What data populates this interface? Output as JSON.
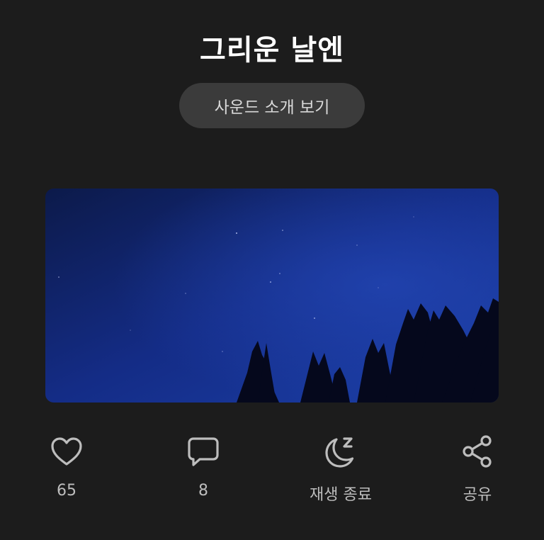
{
  "title": "그리운 날엔",
  "intro_button": "사운드 소개 보기",
  "cover_image": {
    "description_icon": "night-sky-image",
    "sky_color_top": "#0b1540",
    "sky_color_bottom": "#1a3a9e"
  },
  "actions": {
    "like": {
      "icon": "heart-icon",
      "label": "65"
    },
    "comment": {
      "icon": "comment-icon",
      "label": "8"
    },
    "sleep": {
      "icon": "moon-sleep-icon",
      "label": "재생 종료"
    },
    "share": {
      "icon": "share-icon",
      "label": "공유"
    }
  },
  "colors": {
    "background": "#1c1c1c",
    "button_bg": "#3b3b3b",
    "icon": "#bdbdbd"
  }
}
